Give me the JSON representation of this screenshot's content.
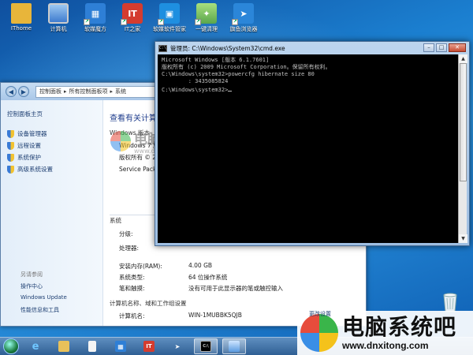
{
  "desktop": {
    "icons": [
      {
        "label": "IThome",
        "icon": "folder-icon",
        "color": "#e8b53a"
      },
      {
        "label": "计算机",
        "icon": "computer-icon",
        "color": "#3f7ccf"
      },
      {
        "label": "软媒魔方",
        "icon": "cube-icon",
        "color": "#2e7fd6"
      },
      {
        "label": "IT之家",
        "icon": "it-home-icon",
        "color": "#d43c2f"
      },
      {
        "label": "软媒软件管家",
        "icon": "software-manager-icon",
        "color": "#1e8fe0"
      },
      {
        "label": "一键清理",
        "icon": "broom-icon",
        "color": "#5aa64c"
      },
      {
        "label": "旗鱼浏览器",
        "icon": "browser-icon",
        "color": "#2b86d9"
      }
    ]
  },
  "control_panel": {
    "breadcrumb": [
      "控制面板",
      "所有控制面板项",
      "系统"
    ],
    "left": {
      "home": "控制面板主页",
      "tasks": [
        "设备管理器",
        "远程设置",
        "系统保护",
        "高级系统设置"
      ],
      "see_also": "另请参阅",
      "links": [
        "操作中心",
        "Windows Update",
        "性能信息和工具"
      ]
    },
    "main": {
      "heading": "查看有关计算机",
      "edition_section": "Windows 版本",
      "edition": "Windows 7 旗",
      "copyright": "版权所有 © 20",
      "service_pack": "Service Pack 1",
      "system_section": "系统",
      "rating_label": "分级:",
      "processor_label": "处理器:",
      "ram_label": "安装内存(RAM):",
      "ram_value": "4.00 GB",
      "type_label": "系统类型:",
      "type_value": "64 位操作系统",
      "pen_label": "笔和触摸:",
      "pen_value": "没有可用于此显示器的笔或触控输入",
      "name_section": "计算机名称、域和工作组设置",
      "computer_name_label": "计算机名:",
      "computer_name_value": "WIN-1MUBBK5QJB",
      "change_link": "更改设置"
    }
  },
  "cmd": {
    "title": "管理员: C:\\Windows\\System32\\cmd.exe",
    "lines": [
      "Microsoft Windows [版本 6.1.7601]",
      "版权所有 (c) 2009 Microsoft Corporation。保留所有权利。",
      "",
      "C:\\Windows\\system32>powercfg hibernate size 80",
      "        : 3435085824",
      "",
      "C:\\Windows\\system32>"
    ]
  },
  "watermark": {
    "name": "电脑系统吧",
    "url": "www.dnxitong.com"
  },
  "taskbar": {
    "items": [
      {
        "icon": "internet-explorer-icon",
        "active": false
      },
      {
        "icon": "file-explorer-icon",
        "active": false
      },
      {
        "icon": "document-icon",
        "active": false
      },
      {
        "icon": "cube-icon",
        "active": false
      },
      {
        "icon": "it-home-icon",
        "active": false
      },
      {
        "icon": "browser-icon",
        "active": false
      },
      {
        "icon": "cmd-icon",
        "active": true
      },
      {
        "icon": "control-panel-icon",
        "active": true
      }
    ]
  }
}
